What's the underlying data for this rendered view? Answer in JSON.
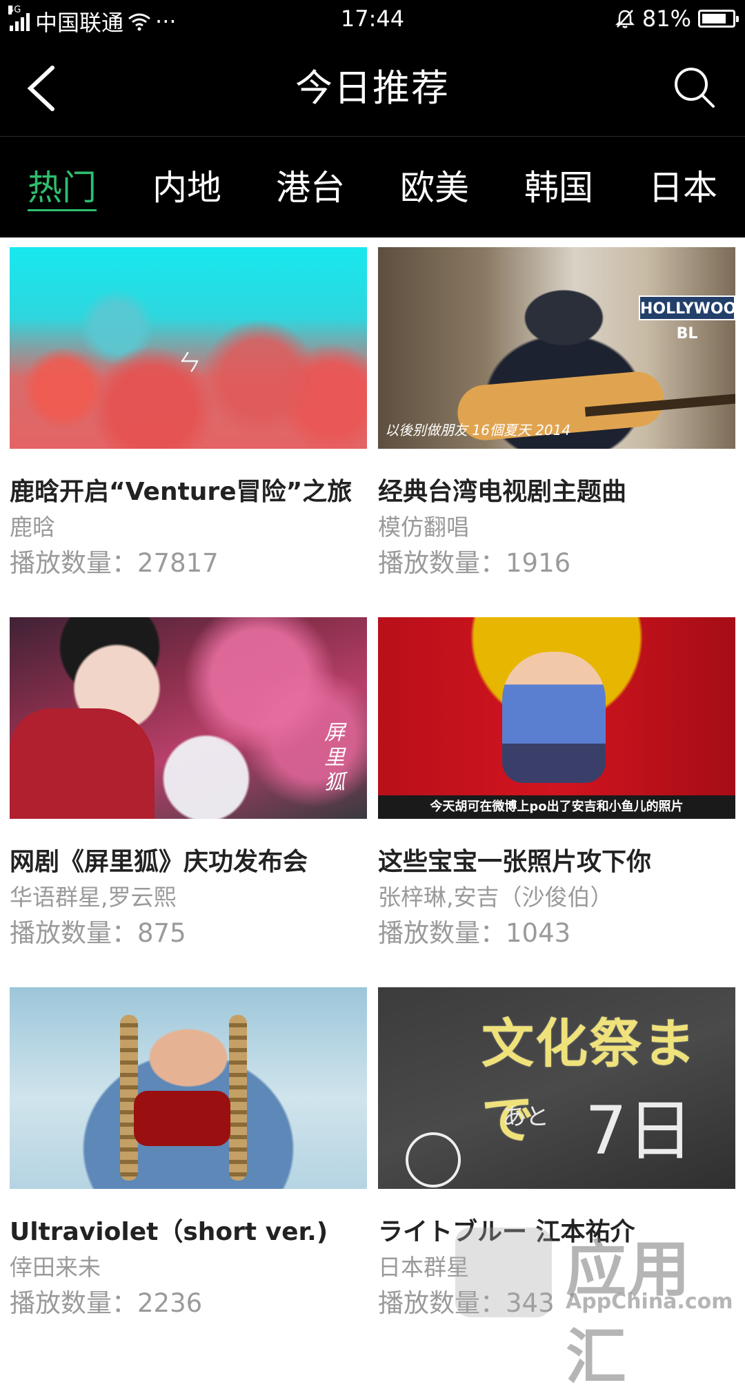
{
  "status_bar": {
    "network_tag": "4G",
    "carrier": "中国联通",
    "more": "···",
    "time": "17:44",
    "battery_percent_text": "81%",
    "battery_level": 0.81
  },
  "header": {
    "title": "今日推荐"
  },
  "tabs": [
    {
      "label": "热门",
      "active": true
    },
    {
      "label": "内地",
      "active": false
    },
    {
      "label": "港台",
      "active": false
    },
    {
      "label": "欧美",
      "active": false
    },
    {
      "label": "韩国",
      "active": false
    },
    {
      "label": "日本",
      "active": false
    }
  ],
  "colors": {
    "accent": "#2ebe6e",
    "bar_background": "#000000"
  },
  "videos": [
    {
      "title": "鹿晗开启“Venture冒险”之旅",
      "artist": "鹿晗",
      "plays": "播放数量：27817",
      "thumb_text": "ㄣ"
    },
    {
      "title": "经典台湾电视剧主题曲",
      "artist": "模仿翻唱",
      "plays": "播放数量：1916",
      "thumb_sign": "HOLLYWOOD BL",
      "thumb_caption": "以後别做朋友 16個夏天 2014"
    },
    {
      "title": "网剧《屏里狐》庆功发布会",
      "artist": "华语群星,罗云熙",
      "plays": "播放数量：875",
      "thumb_text": "屏里狐"
    },
    {
      "title": "这些宝宝一张照片攻下你",
      "artist": "张梓琳,安吉（沙俊伯）",
      "plays": "播放数量：1043",
      "thumb_caption": "今天胡可在微博上po出了安吉和小鱼儿的照片"
    },
    {
      "title": "Ultraviolet（short ver.)",
      "artist": "倖田来未",
      "plays": "播放数量：2236"
    },
    {
      "title": "ライトブルー 江本祐介",
      "artist": "日本群星",
      "plays": "播放数量：343",
      "thumb_text_1": "文化祭まで",
      "thumb_text_2": "あと",
      "thumb_text_3": "7日"
    }
  ],
  "watermark": {
    "text_zh": "应用汇",
    "text_en": "AppChina.com"
  }
}
